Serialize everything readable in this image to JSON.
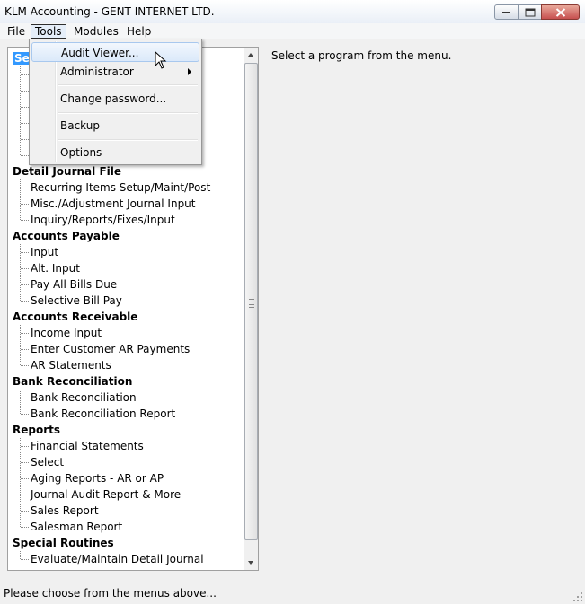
{
  "window": {
    "title": "KLM Accounting - GENT INTERNET LTD."
  },
  "menubar": {
    "items": [
      "File",
      "Tools",
      "Modules",
      "Help"
    ]
  },
  "tools_menu": {
    "items": [
      {
        "label": "Audit Viewer..."
      },
      {
        "label": "Administrator"
      },
      {
        "label": "Change password..."
      },
      {
        "label": "Backup"
      },
      {
        "label": "Options"
      }
    ]
  },
  "tree": {
    "partial_top_label": "Set",
    "categories": [
      {
        "label": "Detail Journal File",
        "items": [
          "Recurring Items Setup/Maint/Post",
          "Misc./Adjustment Journal Input",
          "Inquiry/Reports/Fixes/Input"
        ]
      },
      {
        "label": "Accounts Payable",
        "items": [
          "Input",
          "Alt. Input",
          "Pay All Bills Due",
          "Selective Bill Pay"
        ]
      },
      {
        "label": "Accounts Receivable",
        "items": [
          "Income Input",
          "Enter Customer AR Payments",
          "AR Statements"
        ]
      },
      {
        "label": "Bank Reconciliation",
        "items": [
          "Bank Reconciliation",
          "Bank Reconciliation Report"
        ]
      },
      {
        "label": "Reports",
        "items": [
          "Financial Statements",
          "Select",
          "Aging Reports - AR or AP",
          "Journal Audit Report & More",
          "Sales Report",
          "Salesman Report"
        ]
      },
      {
        "label": "Special Routines",
        "items": [
          "Evaluate/Maintain Detail Journal"
        ]
      }
    ]
  },
  "main": {
    "message": "Select a program from the menu."
  },
  "statusbar": {
    "text": "Please choose from the menus above..."
  },
  "colors": {
    "selection": "#3399ff",
    "close_button": "#c75050"
  }
}
